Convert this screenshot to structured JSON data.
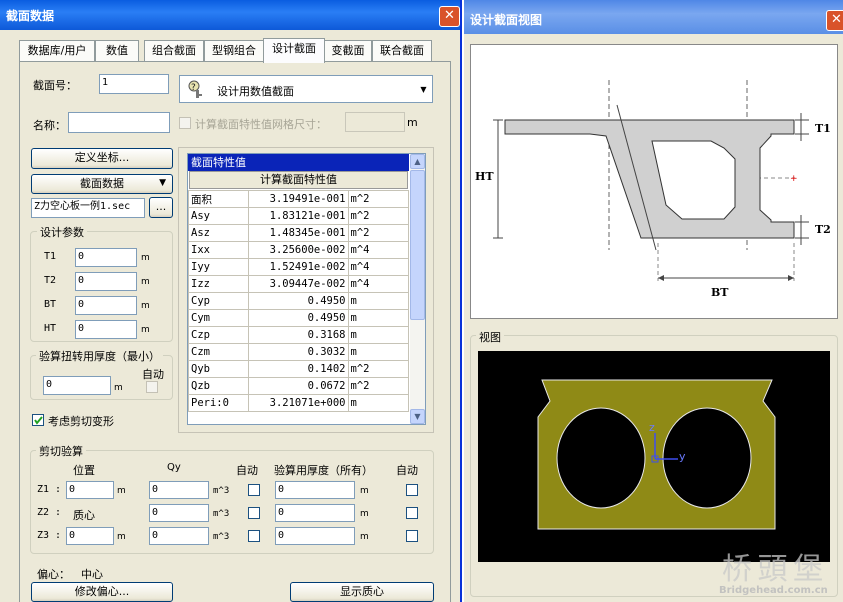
{
  "left_window": {
    "title": "截面数据",
    "tabs": [
      "数据库/用户",
      "数值",
      "组合截面",
      "型钢组合",
      "设计截面",
      "变截面",
      "联合截面"
    ],
    "active_tab": "设计截面",
    "section_no_label": "截面号：",
    "section_no_value": "1",
    "section_type_label": "设计用数值截面",
    "name_label": "名称：",
    "name_value": "",
    "mesh_label": "计算截面特性值网格尺寸：",
    "mesh_unit": "m",
    "define_coord_button": "定义坐标...",
    "section_data_button": "截面数据",
    "file_value": "Z力空心板一例1.sec",
    "browse_button": "...",
    "design_params": {
      "title": "设计参数",
      "rows": [
        {
          "label": "T1",
          "value": "0",
          "unit": "m"
        },
        {
          "label": "T2",
          "value": "0",
          "unit": "m"
        },
        {
          "label": "BT",
          "value": "0",
          "unit": "m"
        },
        {
          "label": "HT",
          "value": "0",
          "unit": "m"
        }
      ]
    },
    "torsion": {
      "title": "验算扭转用厚度（最小）",
      "value": "0",
      "unit": "m",
      "auto_label": "自动"
    },
    "shear_deform_label": "考虑剪切变形",
    "props_table": {
      "header": "截面特性值",
      "calc_button": "计算截面特性值",
      "rows": [
        {
          "name": "面积",
          "value": "3.19491e-001",
          "unit": "m^2"
        },
        {
          "name": "Asy",
          "value": "1.83121e-001",
          "unit": "m^2"
        },
        {
          "name": "Asz",
          "value": "1.48345e-001",
          "unit": "m^2"
        },
        {
          "name": "Ixx",
          "value": "3.25600e-002",
          "unit": "m^4"
        },
        {
          "name": "Iyy",
          "value": "1.52491e-002",
          "unit": "m^4"
        },
        {
          "name": "Izz",
          "value": "3.09447e-002",
          "unit": "m^4"
        },
        {
          "name": "Cyp",
          "value": "0.4950",
          "unit": "m"
        },
        {
          "name": "Cym",
          "value": "0.4950",
          "unit": "m"
        },
        {
          "name": "Czp",
          "value": "0.3168",
          "unit": "m"
        },
        {
          "name": "Czm",
          "value": "0.3032",
          "unit": "m"
        },
        {
          "name": "Qyb",
          "value": "0.1402",
          "unit": "m^2"
        },
        {
          "name": "Qzb",
          "value": "0.0672",
          "unit": "m^2"
        },
        {
          "name": "Peri:0",
          "value": "3.21071e+000",
          "unit": "m"
        }
      ]
    },
    "shear_check": {
      "title": "剪切验算",
      "col_pos": "位置",
      "col_qy": "Qy",
      "col_auto": "自动",
      "col_thick": "验算用厚度（所有）",
      "col_auto2": "自动",
      "rows": [
        {
          "label": "Z1 :",
          "pos": "0",
          "pos_unit": "m",
          "qy": "0",
          "qy_unit": "m^3",
          "thick": "0",
          "thick_unit": "m"
        },
        {
          "label": "Z2 :",
          "pos": "质心",
          "pos_unit": "",
          "qy": "0",
          "qy_unit": "m^3",
          "thick": "0",
          "thick_unit": "m"
        },
        {
          "label": "Z3 :",
          "pos": "0",
          "pos_unit": "m",
          "qy": "0",
          "qy_unit": "m^3",
          "thick": "0",
          "thick_unit": "m"
        }
      ]
    },
    "offset_label": "偏心：",
    "offset_value": "中心",
    "modify_offset_button": "修改偏心...",
    "show_centroid_button": "显示质心"
  },
  "right_window": {
    "title": "设计截面视图",
    "labels": {
      "t1": "T1",
      "t2": "T2",
      "ht": "HT",
      "bt": "BT"
    },
    "view_group": "视图",
    "axis_z": "z",
    "axis_y": "y"
  },
  "watermark": {
    "text": "桥 頭 堡",
    "url": "Bridgehead.com.cn"
  },
  "colors": {
    "title_blue": "#0a5de0",
    "face": "#ece9d8",
    "section_fill": "#8f8a16",
    "view_bg": "#000000",
    "highlight": "#0a24b8"
  }
}
